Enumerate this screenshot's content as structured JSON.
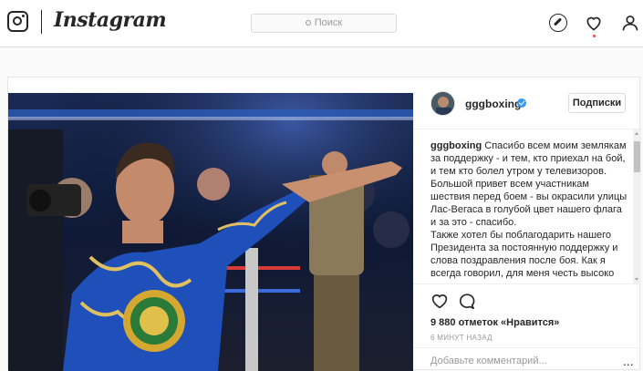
{
  "app": {
    "wordmark": "Instagram"
  },
  "search": {
    "placeholder": "Поиск"
  },
  "nav": {
    "icons": [
      "compass-icon",
      "heart-icon",
      "person-icon"
    ],
    "notification_color": "#ed4956"
  },
  "post": {
    "username": "gggboxing",
    "follow_label": "Подписки",
    "caption_username": "gggboxing",
    "caption_lines": [
      "Спасибо всем моим землякам за поддержку - и тем, кто приехал на бой, и тем кто болел утром у телевизоров.",
      "Большой привет всем участникам шествия перед боем - вы окрасили улицы Лас-Вегаса в голубой цвет нашего флага и за это - спасибо.",
      "Также хотел бы поблагодарить нашего Президента за постоянную поддержку и слова поздравления после боя. Как я всегда говорил, для меня честь высоко"
    ],
    "likes": "9 880 отметок «Нравится»",
    "time": "6 МИНУТ НАЗАД",
    "comment_placeholder": "Добавьте комментарий...",
    "more_label": "...",
    "verified_color": "#3897f0"
  }
}
